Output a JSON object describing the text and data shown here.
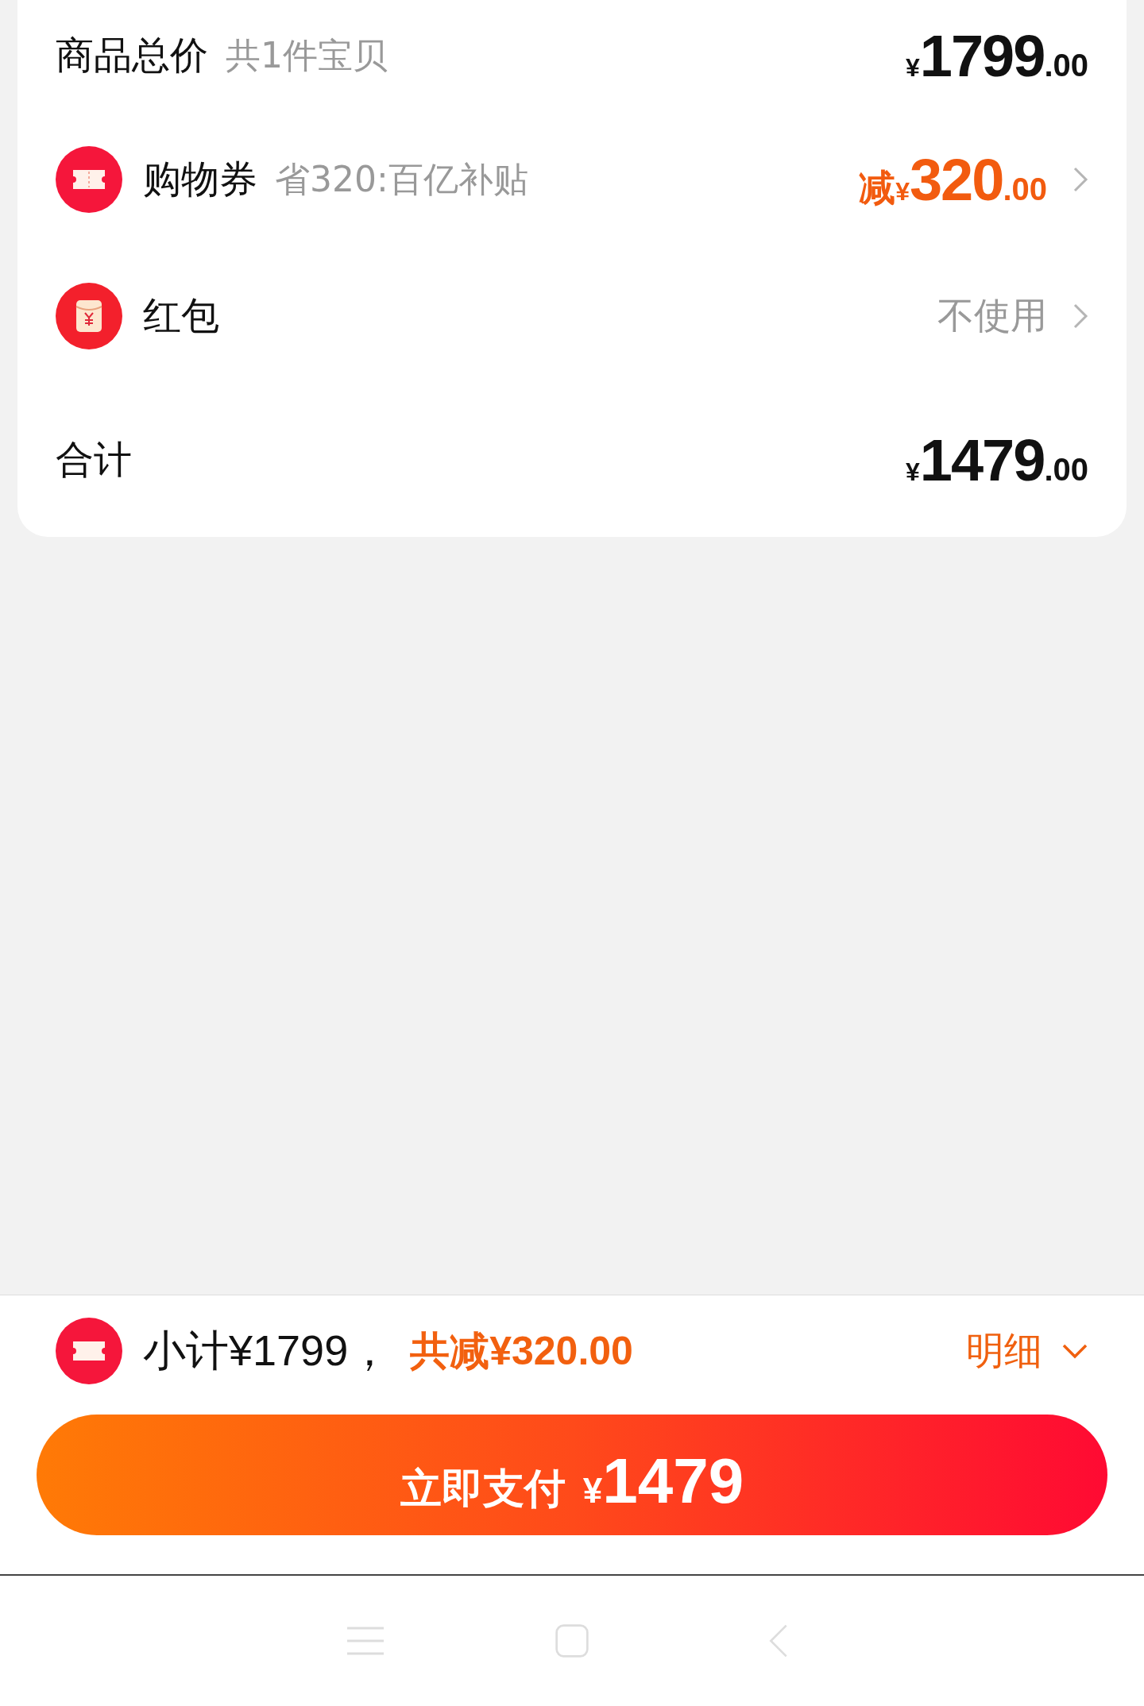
{
  "summary": {
    "rows": [
      {
        "kind": "total",
        "label": "商品总价",
        "note": "共1件宝贝",
        "price": {
          "currency": "¥",
          "integer": "1799",
          "decimal": ".00"
        },
        "chevron": false
      },
      {
        "kind": "coupon",
        "label": "购物券",
        "note": "省320:百亿补贴",
        "price": {
          "prefix": "减",
          "currency": "¥",
          "integer": "320",
          "decimal": ".00"
        },
        "chevron": true
      },
      {
        "kind": "redpacket",
        "label": "红包",
        "value": "不使用",
        "chevron": true
      },
      {
        "kind": "sum",
        "label": "合计",
        "price": {
          "currency": "¥",
          "integer": "1479",
          "decimal": ".00"
        },
        "chevron": false
      }
    ]
  },
  "footer": {
    "subtotal": "小计¥1799，",
    "discount": "共减¥320.00",
    "details": "明细",
    "expanded": false,
    "pay_button": {
      "label": "立即支付",
      "currency": "¥",
      "amount": "1479"
    }
  },
  "nav_bar": [
    {
      "kind": "menu"
    },
    {
      "kind": "home"
    },
    {
      "kind": "back"
    }
  ]
}
